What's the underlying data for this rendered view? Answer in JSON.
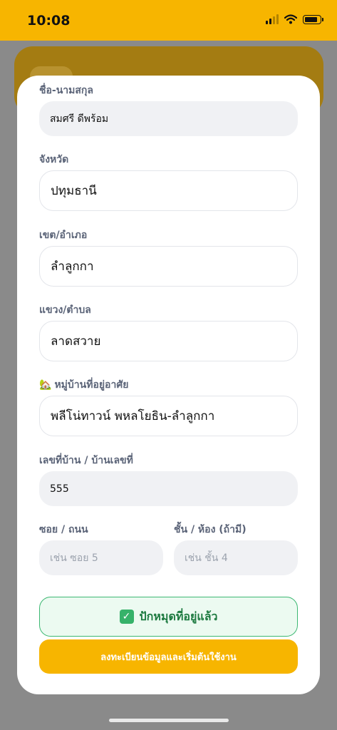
{
  "status_bar": {
    "time": "10:08"
  },
  "form": {
    "fullname": {
      "label": "ชื่อ-นามสกุล",
      "value": "สมศรี ดีพร้อม"
    },
    "province": {
      "label": "จังหวัด",
      "value": "ปทุมธานี"
    },
    "district": {
      "label": "เขต/อำเภอ",
      "value": "ลำลูกกา"
    },
    "subdistrict": {
      "label": "แขวง/ตำบล",
      "value": "ลาดสวาย"
    },
    "village": {
      "label_icon": "🏡",
      "label": "หมู่บ้านที่อยู่อาศัย",
      "value": "พลีโน่ทาวน์ พหลโยธิน-ลำลูกกา"
    },
    "house_no": {
      "label": "เลขที่บ้าน / บ้านเลขที่",
      "value": "555"
    },
    "soi": {
      "label": "ซอย / ถนน",
      "placeholder": "เช่น ซอย 5"
    },
    "floor": {
      "label": "ชั้น / ห้อง (ถ้ามี)",
      "placeholder": "เช่น ชั้น 4"
    }
  },
  "buttons": {
    "pinned_label": "ปักหมุดที่อยู่แล้ว",
    "submit_label": "ลงทะเบียนข้อมูลและเริ่มต้นใช้งาน"
  },
  "colors": {
    "brand": "#f7b500",
    "success_border": "#3cb872",
    "success_bg": "#ecfaf1"
  }
}
